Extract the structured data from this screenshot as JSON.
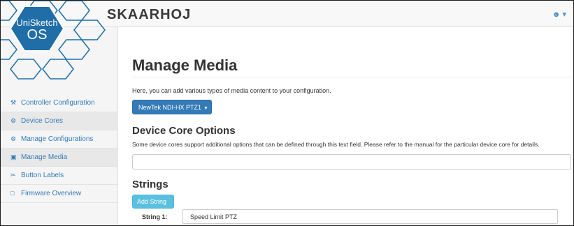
{
  "colors": {
    "primary": "#337ab7",
    "info": "#5bc0de",
    "logo_fill": "#1f6ea8"
  },
  "brand": {
    "name": "SKAARHOJ"
  },
  "logo": {
    "title": "UniSketch",
    "subtitle": "OS"
  },
  "user_menu": {
    "icon": "user-icon"
  },
  "sidebar": {
    "items": [
      {
        "label": "Controller Configuration",
        "icon": "wrench-icon"
      },
      {
        "label": "Device Cores",
        "icon": "cogs-icon"
      },
      {
        "label": "Manage Configurations",
        "icon": "cogs-icon"
      },
      {
        "label": "Manage Media",
        "icon": "image-icon"
      },
      {
        "label": "Button Labels",
        "icon": "scissors-icon"
      },
      {
        "label": "Firmware Overview",
        "icon": "file-icon"
      }
    ]
  },
  "main": {
    "title": "Manage Media",
    "intro": "Here, you can add various types of media content to your configuration.",
    "device_dropdown": "NewTek NDI-HX PTZ1",
    "device_core_options": {
      "heading": "Device Core Options",
      "help": "Some device cores support additional options that can be defined through this text field. Please refer to the manual for the particular device core for details.",
      "value": ""
    },
    "strings": {
      "heading": "Strings",
      "add_label": "Add String",
      "items": [
        {
          "label": "String 1:",
          "value": "Speed Limit PTZ"
        }
      ]
    }
  }
}
